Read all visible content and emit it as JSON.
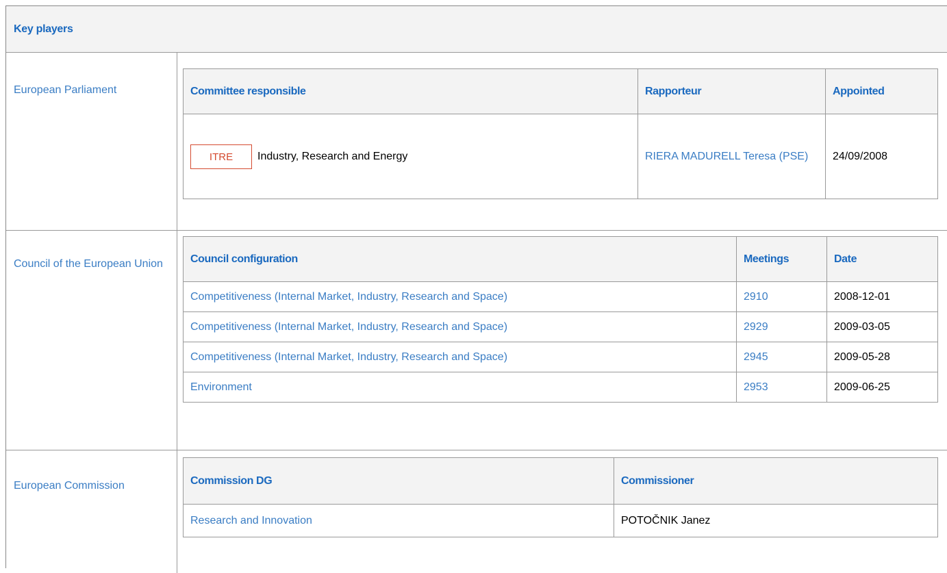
{
  "header": {
    "title": "Key players"
  },
  "parliament": {
    "label": "European Parliament",
    "columns": [
      "Committee responsible",
      "Rapporteur",
      "Appointed"
    ],
    "row": {
      "committee_code": "ITRE",
      "committee_name": "Industry, Research and Energy",
      "rapporteur": "RIERA MADURELL Teresa (PSE)",
      "appointed": "24/09/2008"
    }
  },
  "council": {
    "label": "Council of the European Union",
    "columns": [
      "Council configuration",
      "Meetings",
      "Date"
    ],
    "rows": [
      {
        "configuration": "Competitiveness (Internal Market, Industry, Research and Space)",
        "meeting": "2910",
        "date": "2008-12-01"
      },
      {
        "configuration": "Competitiveness (Internal Market, Industry, Research and Space)",
        "meeting": "2929",
        "date": "2009-03-05"
      },
      {
        "configuration": "Competitiveness (Internal Market, Industry, Research and Space)",
        "meeting": "2945",
        "date": "2009-05-28"
      },
      {
        "configuration": "Environment",
        "meeting": "2953",
        "date": "2009-06-25"
      }
    ]
  },
  "commission": {
    "label": "European Commission",
    "columns": [
      "Commission DG",
      "Commissioner"
    ],
    "row": {
      "dg": "Research and Innovation",
      "commissioner": "POTOČNIK Janez"
    }
  },
  "colors": {
    "header_text": "#1a69bf",
    "link": "#3a7dc4",
    "badge": "#d44a2f",
    "header_bg": "#f3f3f3",
    "border": "#999999"
  }
}
